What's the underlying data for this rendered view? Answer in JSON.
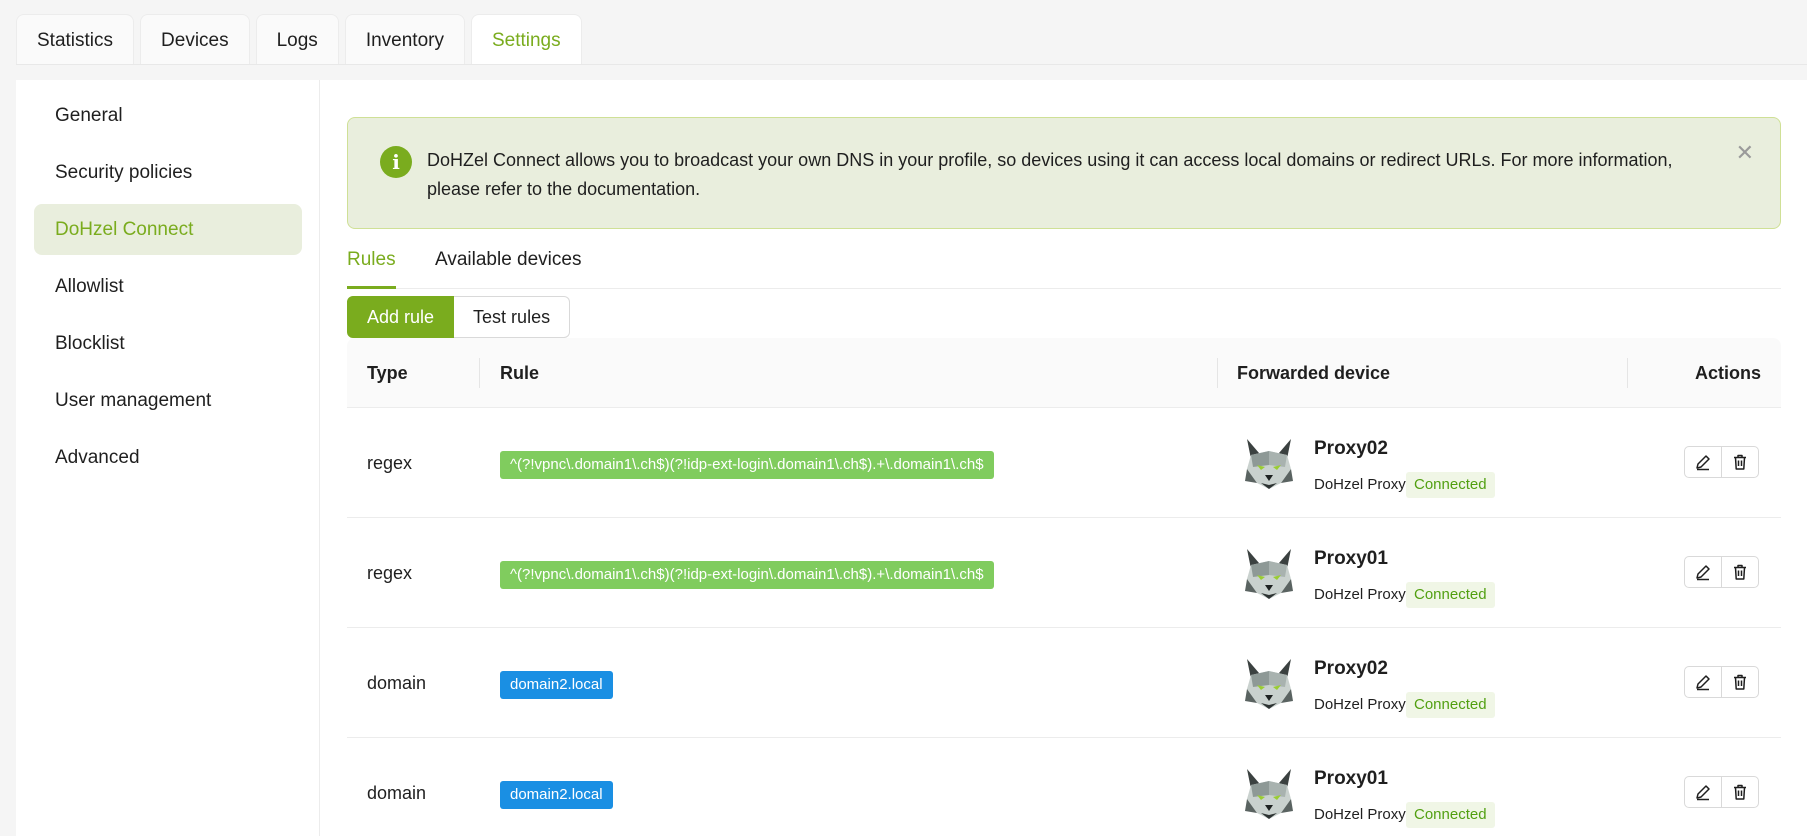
{
  "top_tabs": [
    {
      "label": "Statistics"
    },
    {
      "label": "Devices"
    },
    {
      "label": "Logs"
    },
    {
      "label": "Inventory"
    },
    {
      "label": "Settings",
      "active": true
    }
  ],
  "sidebar": {
    "items": [
      {
        "label": "General"
      },
      {
        "label": "Security policies"
      },
      {
        "label": "DoHzel Connect",
        "active": true
      },
      {
        "label": "Allowlist"
      },
      {
        "label": "Blocklist"
      },
      {
        "label": "User management"
      },
      {
        "label": "Advanced"
      }
    ]
  },
  "alert": {
    "icon": "info-icon",
    "text": "DoHZel Connect allows you to broadcast your own DNS in your profile, so devices using it can access local domains or redirect URLs. For more information, please refer to the documentation."
  },
  "sub_tabs": [
    {
      "label": "Rules",
      "active": true
    },
    {
      "label": "Available devices"
    }
  ],
  "buttons": {
    "add_rule": "Add rule",
    "test_rules": "Test rules"
  },
  "table": {
    "headers": {
      "type": "Type",
      "rule": "Rule",
      "device": "Forwarded device",
      "actions": "Actions"
    },
    "rows": [
      {
        "type": "regex",
        "rule": "^(?!vpnc\\.domain1\\.ch$)(?!idp-ext-login\\.domain1\\.ch$).+\\.domain1\\.ch$",
        "device_name": "Proxy02",
        "device_type": "DoHzel Proxy",
        "status": "Connected"
      },
      {
        "type": "regex",
        "rule": "^(?!vpnc\\.domain1\\.ch$)(?!idp-ext-login\\.domain1\\.ch$).+\\.domain1\\.ch$",
        "device_name": "Proxy01",
        "device_type": "DoHzel Proxy",
        "status": "Connected"
      },
      {
        "type": "domain",
        "rule": "domain2.local",
        "device_name": "Proxy02",
        "device_type": "DoHzel Proxy",
        "status": "Connected"
      },
      {
        "type": "domain",
        "rule": "domain2.local",
        "device_name": "Proxy01",
        "device_type": "DoHzel Proxy",
        "status": "Connected"
      }
    ]
  },
  "colors": {
    "accent": "#7aac1e",
    "regex_tag": "#80cc5e",
    "domain_tag": "#1a8fe3",
    "status_bg": "#f0f6e6",
    "status_text": "#52a012"
  }
}
